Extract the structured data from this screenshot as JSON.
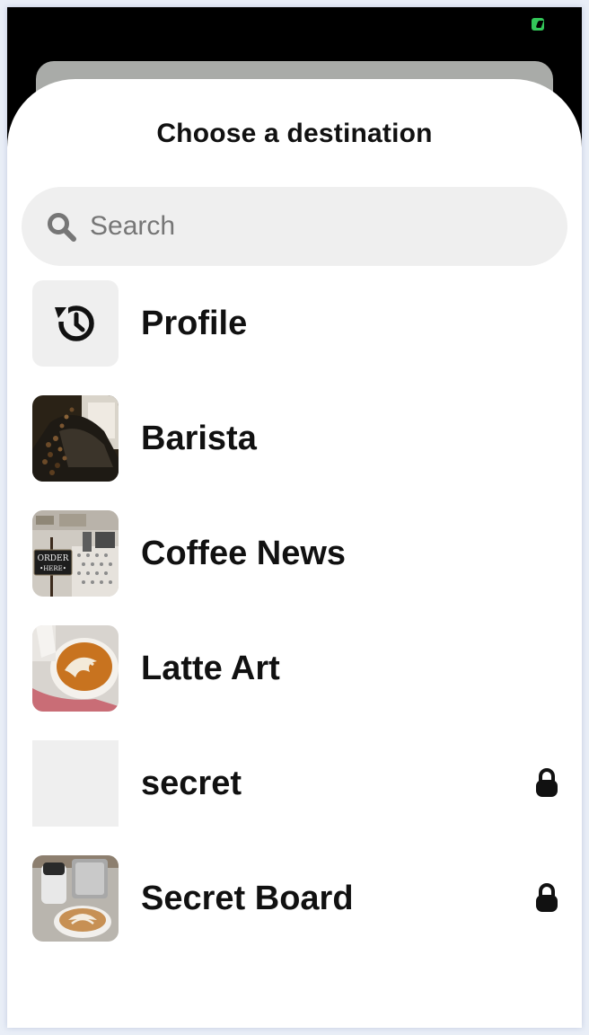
{
  "sheet": {
    "title": "Choose a destination"
  },
  "search": {
    "placeholder": "Search",
    "value": ""
  },
  "boards": [
    {
      "name": "Profile",
      "thumbnail": "history-icon",
      "secret": false
    },
    {
      "name": "Barista",
      "thumbnail": "coffee-beans-photo",
      "secret": false
    },
    {
      "name": "Coffee News",
      "thumbnail": "cafe-order-here-photo",
      "secret": false
    },
    {
      "name": "Latte Art",
      "thumbnail": "latte-art-pour-photo",
      "secret": false
    },
    {
      "name": "secret",
      "thumbnail": "empty-placeholder",
      "secret": true
    },
    {
      "name": "Secret Board",
      "thumbnail": "latte-cup-photo",
      "secret": true
    }
  ],
  "colors": {
    "status_battery": "#33c759",
    "sheet_background": "#ffffff",
    "search_background": "#efefef",
    "text": "#111111",
    "placeholder": "#767676"
  }
}
